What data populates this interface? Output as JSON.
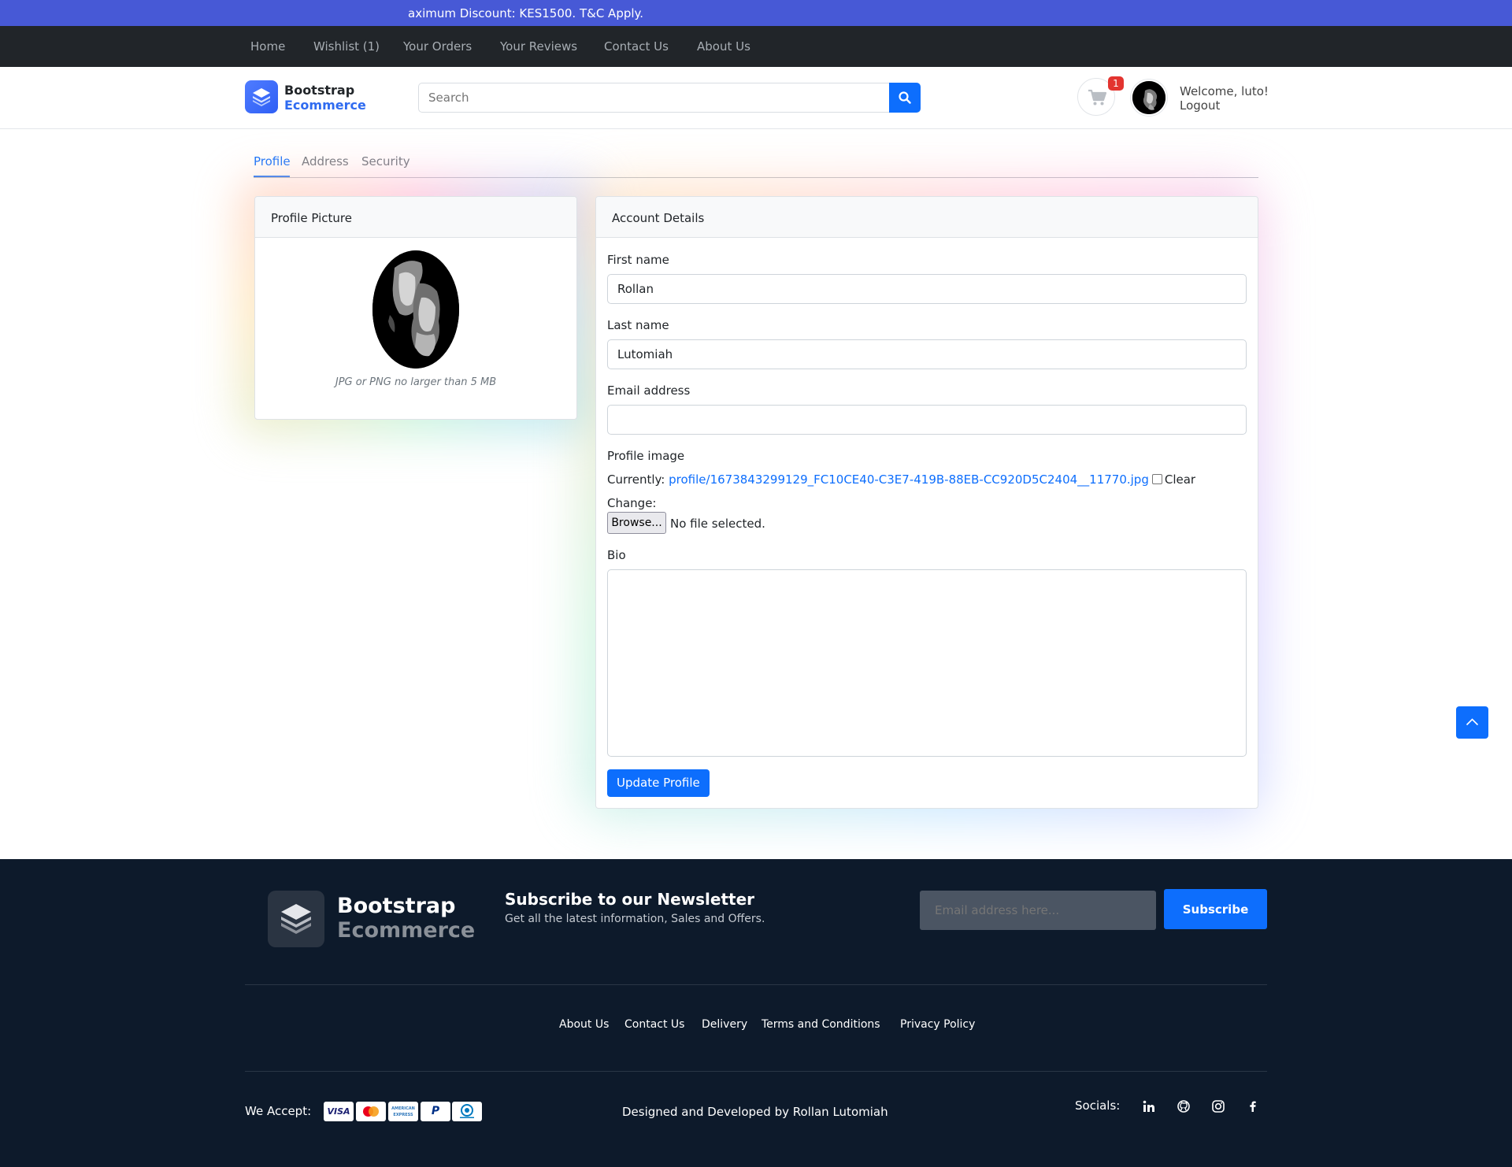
{
  "promo": {
    "text": "aximum Discount: KES1500. T&C Apply."
  },
  "topnav": {
    "items": [
      "Home",
      "Wishlist (1)",
      "Your Orders",
      "Your Reviews",
      "Contact Us",
      "About Us"
    ]
  },
  "header": {
    "logo_line1": "Bootstrap",
    "logo_line2": "Ecommerce",
    "search_placeholder": "Search",
    "cart_count": "1",
    "welcome": "Welcome, luto!",
    "logout": "Logout",
    "icons": [
      "layers-icon",
      "search-icon",
      "cart-icon"
    ]
  },
  "tabs": [
    {
      "label": "Profile",
      "active": true
    },
    {
      "label": "Address",
      "active": false
    },
    {
      "label": "Security",
      "active": false
    }
  ],
  "profile_picture": {
    "title": "Profile Picture",
    "caption": "JPG or PNG no larger than 5 MB"
  },
  "account": {
    "title": "Account Details",
    "first_name_label": "First name",
    "first_name_value": "Rollan",
    "last_name_label": "Last name",
    "last_name_value": "Lutomiah",
    "email_label": "Email address",
    "email_value": "",
    "profile_image_label": "Profile image",
    "currently_label": "Currently:",
    "current_file": "profile/1673843299129_FC10CE40-C3E7-419B-88EB-CC920D5C2404__11770.jpg",
    "clear_label": "Clear",
    "change_label": "Change:",
    "browse_label": "Browse...",
    "no_file": "No file selected.",
    "bio_label": "Bio",
    "bio_value": "",
    "submit_label": "Update Profile"
  },
  "footer": {
    "logo_line1": "Bootstrap",
    "logo_line2": "Ecommerce",
    "newsletter_title": "Subscribe to our Newsletter",
    "newsletter_sub": "Get all the latest information, Sales and Offers.",
    "email_placeholder": "Email address here...",
    "subscribe_label": "Subscribe",
    "links": [
      "About Us",
      "Contact Us",
      "Delivery",
      "Terms and Conditions",
      "Privacy Policy"
    ],
    "we_accept": "We Accept:",
    "payment_methods": [
      "VISA",
      "Mastercard",
      "American Express",
      "PayPal",
      "Diners Club"
    ],
    "designed_by": "Designed and Developed by  Rollan Lutomiah",
    "socials_label": "Socials:",
    "social_icons": [
      "linkedin-icon",
      "github-icon",
      "instagram-icon",
      "facebook-icon"
    ]
  },
  "colors": {
    "promo_bg": "#4759d6",
    "nav_bg": "#212529",
    "primary": "#0d6efd",
    "footer_bg": "#0d1a2b",
    "badge": "#e3342f"
  }
}
